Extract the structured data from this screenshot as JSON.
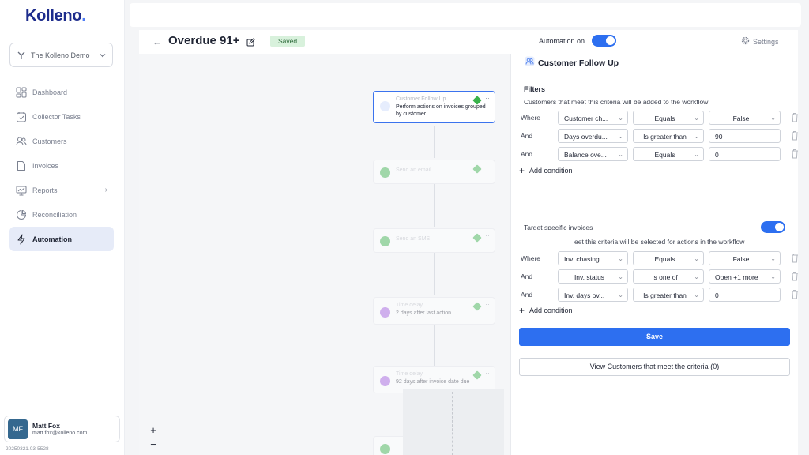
{
  "app": {
    "logo": "Kolleno",
    "logo_dot": "."
  },
  "org": {
    "name": "The Kolleno Demo"
  },
  "nav": [
    {
      "label": "Dashboard",
      "icon": "dashboard-icon"
    },
    {
      "label": "Collector Tasks",
      "icon": "tasks-icon"
    },
    {
      "label": "Customers",
      "icon": "customers-icon"
    },
    {
      "label": "Invoices",
      "icon": "invoices-icon"
    },
    {
      "label": "Reports",
      "icon": "reports-icon"
    },
    {
      "label": "Reconciliation",
      "icon": "reconciliation-icon"
    },
    {
      "label": "Automation",
      "icon": "automation-icon"
    }
  ],
  "user": {
    "initials": "MF",
    "name": "Matt Fox",
    "email": "matt.fox@kolleno.com"
  },
  "version": "20250321.03-5528",
  "header": {
    "title": "Overdue 91+",
    "status": "Saved",
    "automation_label": "Automation on",
    "settings_label": "Settings"
  },
  "workflow": {
    "nodes": [
      {
        "title": "Customer Follow Up",
        "subtitle": "Perform actions on invoices grouped by customer",
        "icon": "customers-icon",
        "color": "#5b8af0"
      },
      {
        "title": "Send an email",
        "subtitle": "",
        "icon": "email-icon",
        "color": "#3ab24b"
      },
      {
        "title": "Send an SMS",
        "subtitle": "",
        "icon": "sms-icon",
        "color": "#3ab24b"
      },
      {
        "title": "Time delay",
        "subtitle": "2 days after last action",
        "icon": "clock-icon",
        "color": "#a25ae0"
      },
      {
        "title": "Time delay",
        "subtitle": "92 days after invoice date due",
        "icon": "clock-icon",
        "color": "#a25ae0"
      }
    ],
    "zoom_in": "+",
    "zoom_out": "−"
  },
  "panel": {
    "title": "Customer Follow Up",
    "filters_title": "Filters",
    "filters_desc": "Customers that meet this criteria will be added to the workflow",
    "customer_rows": [
      {
        "prefix": "Where",
        "field": "Customer ch...",
        "operator": "Equals",
        "value": "False",
        "value_type": "select"
      },
      {
        "prefix": "And",
        "field": "Days overdu...",
        "operator": "Is greater than",
        "value": "90",
        "value_type": "input"
      },
      {
        "prefix": "And",
        "field": "Balance ove...",
        "operator": "Equals",
        "value": "0",
        "value_type": "input"
      }
    ],
    "add_condition": "Add condition",
    "target_label": "Target specific invoices",
    "target_desc": "eet this criteria will be selected for actions in the workflow",
    "invoice_rows": [
      {
        "prefix": "Where",
        "field": "Inv. chasing ...",
        "operator": "Equals",
        "value": "False",
        "value_type": "select"
      },
      {
        "prefix": "And",
        "field": "Inv. status",
        "operator": "Is one of",
        "value": "Open +1 more",
        "value_type": "select"
      },
      {
        "prefix": "And",
        "field": "Inv. days ov...",
        "operator": "Is greater than",
        "value": "0",
        "value_type": "input"
      }
    ],
    "save_label": "Save",
    "view_label": "View Customers that meet the criteria (0)"
  }
}
